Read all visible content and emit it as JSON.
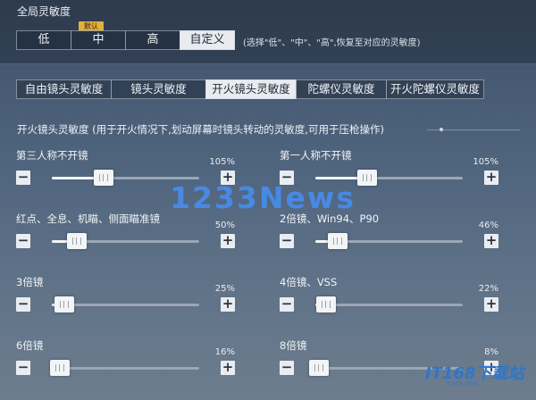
{
  "header": {
    "title": "全局灵敏度"
  },
  "presets": {
    "items": [
      "低",
      "中",
      "高",
      "自定义"
    ],
    "active_index": 3,
    "default_tag": "默认",
    "hint": "(选择\"低\"、\"中\"、\"高\",恢复至对应的灵敏度)"
  },
  "tabs": {
    "items": [
      "自由镜头灵敏度",
      "镜头灵敏度",
      "开火镜头灵敏度",
      "陀螺仪灵敏度",
      "开火陀螺仪灵敏度"
    ],
    "active_index": 2
  },
  "section": {
    "title": "开火镜头灵敏度 (用于开火情况下,划动屏幕时镜头转动的灵敏度,可用于压枪操作)"
  },
  "sliders": [
    {
      "label": "第三人称不开镜",
      "value_text": "105%",
      "value": 105,
      "min": 0,
      "max": 300
    },
    {
      "label": "第一人称不开镜",
      "value_text": "105%",
      "value": 105,
      "min": 0,
      "max": 300
    },
    {
      "label": "红点、全息、机瞄、侧面瞄准镜",
      "value_text": "50%",
      "value": 50,
      "min": 0,
      "max": 300
    },
    {
      "label": "2倍镜、Win94、P90",
      "value_text": "46%",
      "value": 46,
      "min": 0,
      "max": 300
    },
    {
      "label": "3倍镜",
      "value_text": "25%",
      "value": 25,
      "min": 0,
      "max": 300
    },
    {
      "label": "4倍镜、VSS",
      "value_text": "22%",
      "value": 22,
      "min": 0,
      "max": 300
    },
    {
      "label": "6倍镜",
      "value_text": "16%",
      "value": 16,
      "min": 0,
      "max": 300
    },
    {
      "label": "8倍镜",
      "value_text": "8%",
      "value": 8,
      "min": 0,
      "max": 300
    }
  ],
  "controls": {
    "minus": "−",
    "plus": "+"
  },
  "watermark": {
    "text": "1233News"
  },
  "logo": {
    "main": "IT168下载站",
    "sub": "it168.com"
  }
}
